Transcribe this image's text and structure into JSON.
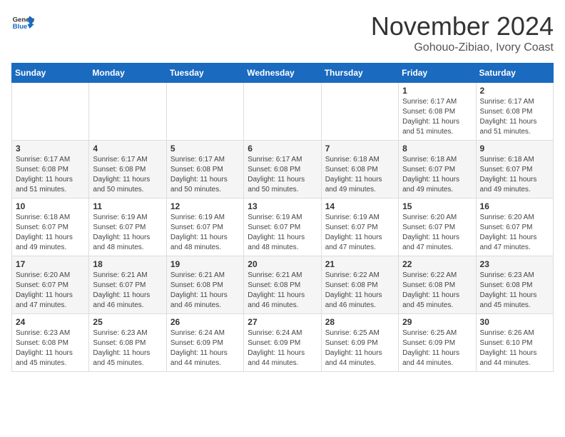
{
  "header": {
    "logo_general": "General",
    "logo_blue": "Blue",
    "title": "November 2024",
    "subtitle": "Gohouo-Zibiao, Ivory Coast"
  },
  "weekdays": [
    "Sunday",
    "Monday",
    "Tuesday",
    "Wednesday",
    "Thursday",
    "Friday",
    "Saturday"
  ],
  "weeks": [
    [
      {
        "day": "",
        "detail": ""
      },
      {
        "day": "",
        "detail": ""
      },
      {
        "day": "",
        "detail": ""
      },
      {
        "day": "",
        "detail": ""
      },
      {
        "day": "",
        "detail": ""
      },
      {
        "day": "1",
        "detail": "Sunrise: 6:17 AM\nSunset: 6:08 PM\nDaylight: 11 hours and 51 minutes."
      },
      {
        "day": "2",
        "detail": "Sunrise: 6:17 AM\nSunset: 6:08 PM\nDaylight: 11 hours and 51 minutes."
      }
    ],
    [
      {
        "day": "3",
        "detail": "Sunrise: 6:17 AM\nSunset: 6:08 PM\nDaylight: 11 hours and 51 minutes."
      },
      {
        "day": "4",
        "detail": "Sunrise: 6:17 AM\nSunset: 6:08 PM\nDaylight: 11 hours and 50 minutes."
      },
      {
        "day": "5",
        "detail": "Sunrise: 6:17 AM\nSunset: 6:08 PM\nDaylight: 11 hours and 50 minutes."
      },
      {
        "day": "6",
        "detail": "Sunrise: 6:17 AM\nSunset: 6:08 PM\nDaylight: 11 hours and 50 minutes."
      },
      {
        "day": "7",
        "detail": "Sunrise: 6:18 AM\nSunset: 6:08 PM\nDaylight: 11 hours and 49 minutes."
      },
      {
        "day": "8",
        "detail": "Sunrise: 6:18 AM\nSunset: 6:07 PM\nDaylight: 11 hours and 49 minutes."
      },
      {
        "day": "9",
        "detail": "Sunrise: 6:18 AM\nSunset: 6:07 PM\nDaylight: 11 hours and 49 minutes."
      }
    ],
    [
      {
        "day": "10",
        "detail": "Sunrise: 6:18 AM\nSunset: 6:07 PM\nDaylight: 11 hours and 49 minutes."
      },
      {
        "day": "11",
        "detail": "Sunrise: 6:19 AM\nSunset: 6:07 PM\nDaylight: 11 hours and 48 minutes."
      },
      {
        "day": "12",
        "detail": "Sunrise: 6:19 AM\nSunset: 6:07 PM\nDaylight: 11 hours and 48 minutes."
      },
      {
        "day": "13",
        "detail": "Sunrise: 6:19 AM\nSunset: 6:07 PM\nDaylight: 11 hours and 48 minutes."
      },
      {
        "day": "14",
        "detail": "Sunrise: 6:19 AM\nSunset: 6:07 PM\nDaylight: 11 hours and 47 minutes."
      },
      {
        "day": "15",
        "detail": "Sunrise: 6:20 AM\nSunset: 6:07 PM\nDaylight: 11 hours and 47 minutes."
      },
      {
        "day": "16",
        "detail": "Sunrise: 6:20 AM\nSunset: 6:07 PM\nDaylight: 11 hours and 47 minutes."
      }
    ],
    [
      {
        "day": "17",
        "detail": "Sunrise: 6:20 AM\nSunset: 6:07 PM\nDaylight: 11 hours and 47 minutes."
      },
      {
        "day": "18",
        "detail": "Sunrise: 6:21 AM\nSunset: 6:07 PM\nDaylight: 11 hours and 46 minutes."
      },
      {
        "day": "19",
        "detail": "Sunrise: 6:21 AM\nSunset: 6:08 PM\nDaylight: 11 hours and 46 minutes."
      },
      {
        "day": "20",
        "detail": "Sunrise: 6:21 AM\nSunset: 6:08 PM\nDaylight: 11 hours and 46 minutes."
      },
      {
        "day": "21",
        "detail": "Sunrise: 6:22 AM\nSunset: 6:08 PM\nDaylight: 11 hours and 46 minutes."
      },
      {
        "day": "22",
        "detail": "Sunrise: 6:22 AM\nSunset: 6:08 PM\nDaylight: 11 hours and 45 minutes."
      },
      {
        "day": "23",
        "detail": "Sunrise: 6:23 AM\nSunset: 6:08 PM\nDaylight: 11 hours and 45 minutes."
      }
    ],
    [
      {
        "day": "24",
        "detail": "Sunrise: 6:23 AM\nSunset: 6:08 PM\nDaylight: 11 hours and 45 minutes."
      },
      {
        "day": "25",
        "detail": "Sunrise: 6:23 AM\nSunset: 6:08 PM\nDaylight: 11 hours and 45 minutes."
      },
      {
        "day": "26",
        "detail": "Sunrise: 6:24 AM\nSunset: 6:09 PM\nDaylight: 11 hours and 44 minutes."
      },
      {
        "day": "27",
        "detail": "Sunrise: 6:24 AM\nSunset: 6:09 PM\nDaylight: 11 hours and 44 minutes."
      },
      {
        "day": "28",
        "detail": "Sunrise: 6:25 AM\nSunset: 6:09 PM\nDaylight: 11 hours and 44 minutes."
      },
      {
        "day": "29",
        "detail": "Sunrise: 6:25 AM\nSunset: 6:09 PM\nDaylight: 11 hours and 44 minutes."
      },
      {
        "day": "30",
        "detail": "Sunrise: 6:26 AM\nSunset: 6:10 PM\nDaylight: 11 hours and 44 minutes."
      }
    ]
  ]
}
